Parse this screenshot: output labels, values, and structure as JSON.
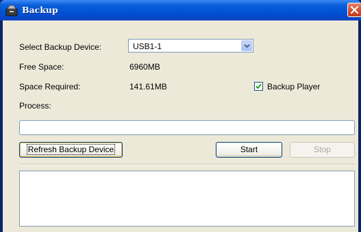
{
  "window": {
    "title": "Backup",
    "app_icon": "archive-box-icon",
    "close_icon": "close-icon"
  },
  "form": {
    "device_label": "Select Backup Device:",
    "device_value": "USB1-1",
    "free_label": "Free Space:",
    "free_value": "6960MB",
    "required_label": "Space Required:",
    "required_value": "141.61MB",
    "backup_player_label": "Backup Player",
    "backup_player_checked": true,
    "process_label": "Process:",
    "progress": 0
  },
  "buttons": {
    "refresh": "Refresh Backup Device",
    "start": "Start",
    "stop": "Stop",
    "stop_enabled": false
  },
  "log": {
    "text": ""
  },
  "colors": {
    "title_bar": "#0052d6",
    "dialog_bg": "#ece9d8",
    "close_button": "#d04a2c"
  }
}
